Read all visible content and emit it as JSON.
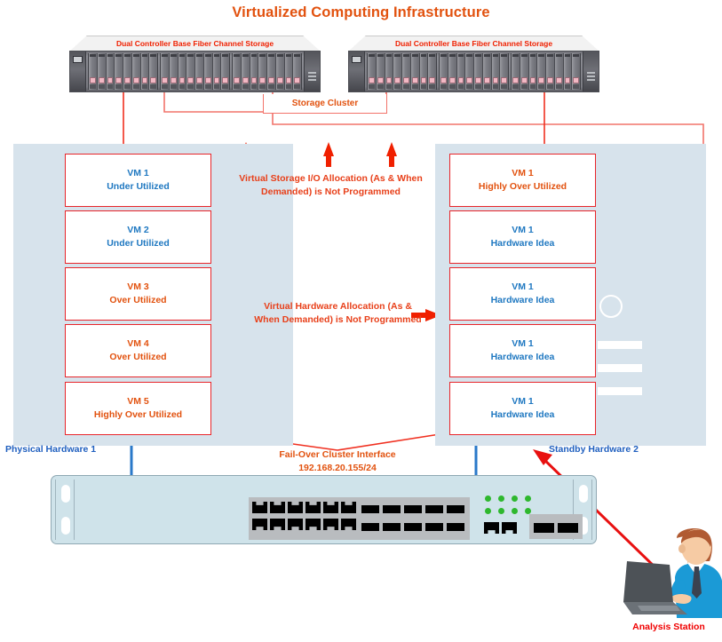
{
  "title": "Virtualized Computing Infrastructure",
  "storage": {
    "left_label": "Dual Controller Base Fiber Channel Storage",
    "right_label": "Dual Controller Base Fiber Channel Storage",
    "cluster_label": "Storage Cluster"
  },
  "left_panel": {
    "label": "Physical Hardware 1",
    "vms": [
      {
        "name": "VM 1",
        "status": "Under Utilized",
        "tone": "blue"
      },
      {
        "name": "VM 2",
        "status": "Under Utilized",
        "tone": "blue"
      },
      {
        "name": "VM 3",
        "status": "Over Utilized",
        "tone": "orange"
      },
      {
        "name": "VM 4",
        "status": "Over Utilized",
        "tone": "orange"
      },
      {
        "name": "VM 5",
        "status": "Highly Over Utilized",
        "tone": "orange"
      }
    ]
  },
  "right_panel": {
    "label": "Standby Hardware 2",
    "vms": [
      {
        "name": "VM 1",
        "status": "Highly Over Utilized",
        "tone": "orange"
      },
      {
        "name": "VM 1",
        "status": "Hardware Idea",
        "tone": "blue"
      },
      {
        "name": "VM 1",
        "status": "Hardware Idea",
        "tone": "blue"
      },
      {
        "name": "VM 1",
        "status": "Hardware Idea",
        "tone": "blue"
      },
      {
        "name": "VM 1",
        "status": "Hardware Idea",
        "tone": "blue"
      }
    ]
  },
  "annotations": {
    "storage_io": "Virtual Storage I/O Allocation (As & When Demanded) is Not Programmed",
    "hardware_alloc": "Virtual Hardware Allocation (As & When Demanded) is Not Programmed"
  },
  "failover": {
    "line1": "Fail-Over Cluster Interface",
    "line2": "192.168.20.155/24"
  },
  "analysis": {
    "label": "Analysis Station"
  },
  "colors": {
    "title": "#e2520f",
    "vm_border": "#e8252a",
    "vm_blue_text": "#1f78c1",
    "vm_orange_text": "#e2520f",
    "panel_bg": "#d7e3ec",
    "annotation": "#e8401a",
    "hardware_label": "#1f5fbf",
    "analysis_label": "#f00000",
    "connector": "#f03020",
    "switch_body": "#cfe3ea",
    "switch_led": "#2eb82e"
  }
}
